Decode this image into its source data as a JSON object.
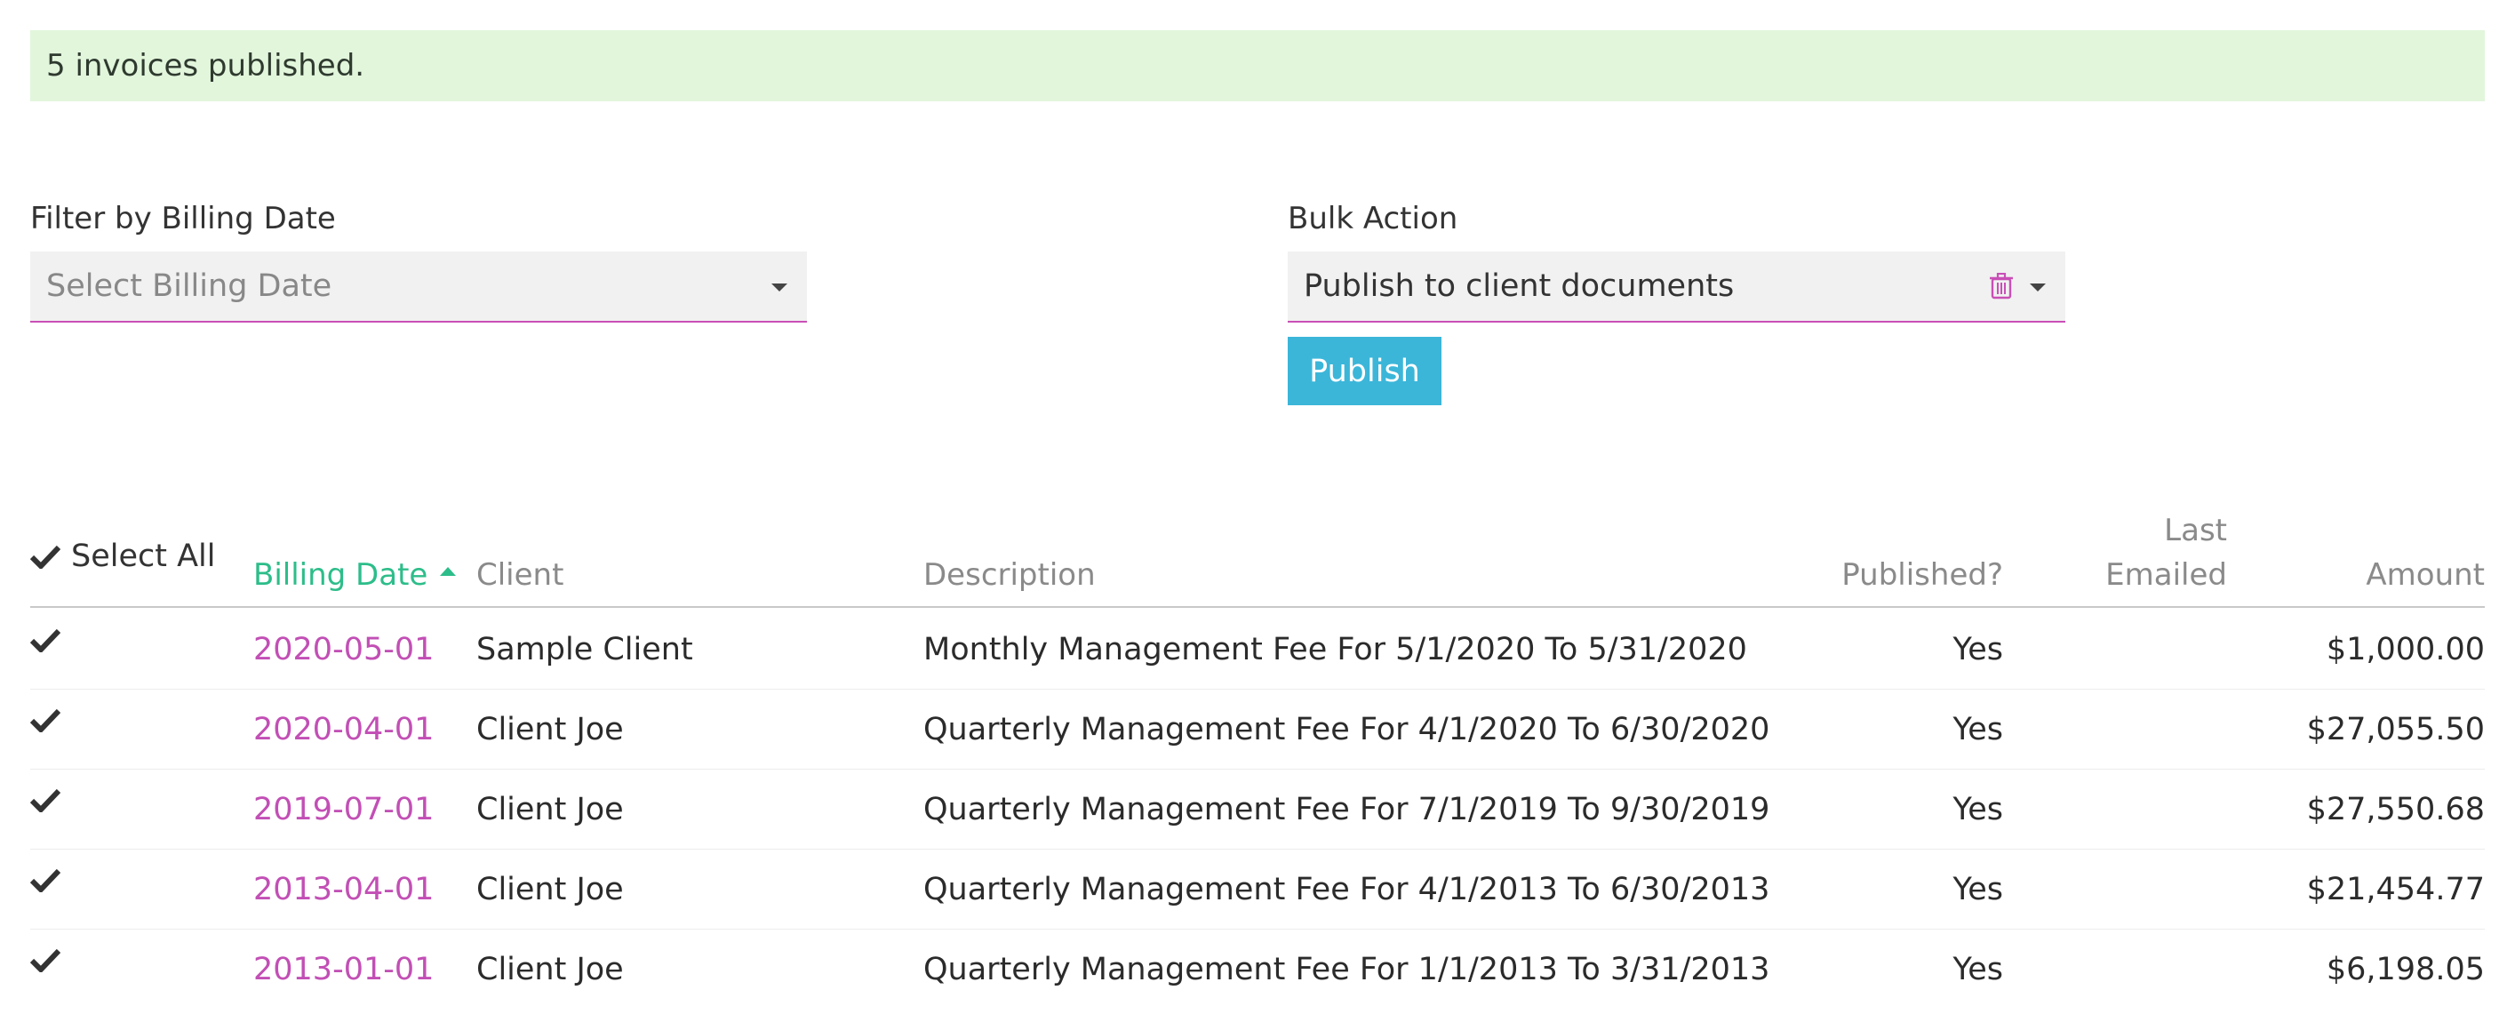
{
  "alert": {
    "message": "5 invoices published."
  },
  "filter": {
    "label": "Filter by Billing Date",
    "placeholder": "Select Billing Date"
  },
  "bulk_action": {
    "label": "Bulk Action",
    "selected": "Publish to client documents",
    "button_label": "Publish"
  },
  "colors": {
    "accent": "#c94fb6",
    "sorted_header": "#2dbd8a",
    "button": "#3bb6d9",
    "alert_bg": "#e2f6dc"
  },
  "table": {
    "select_all_label": "Select All",
    "columns": {
      "billing_date": "Billing Date",
      "client": "Client",
      "description": "Description",
      "published": "Published?",
      "last_emailed_line1": "Last",
      "last_emailed_line2": "Emailed",
      "amount": "Amount"
    },
    "rows": [
      {
        "billing_date": "2020-05-01",
        "client": "Sample Client",
        "description": "Monthly Management Fee For 5/1/2020 To 5/31/2020",
        "published": "Yes",
        "last_emailed": "",
        "amount": "$1,000.00"
      },
      {
        "billing_date": "2020-04-01",
        "client": "Client Joe",
        "description": "Quarterly Management Fee For 4/1/2020 To 6/30/2020",
        "published": "Yes",
        "last_emailed": "",
        "amount": "$27,055.50"
      },
      {
        "billing_date": "2019-07-01",
        "client": "Client Joe",
        "description": "Quarterly Management Fee For 7/1/2019 To 9/30/2019",
        "published": "Yes",
        "last_emailed": "",
        "amount": "$27,550.68"
      },
      {
        "billing_date": "2013-04-01",
        "client": "Client Joe",
        "description": "Quarterly Management Fee For 4/1/2013 To 6/30/2013",
        "published": "Yes",
        "last_emailed": "",
        "amount": "$21,454.77"
      },
      {
        "billing_date": "2013-01-01",
        "client": "Client Joe",
        "description": "Quarterly Management Fee For 1/1/2013 To 3/31/2013",
        "published": "Yes",
        "last_emailed": "",
        "amount": "$6,198.05"
      }
    ]
  }
}
